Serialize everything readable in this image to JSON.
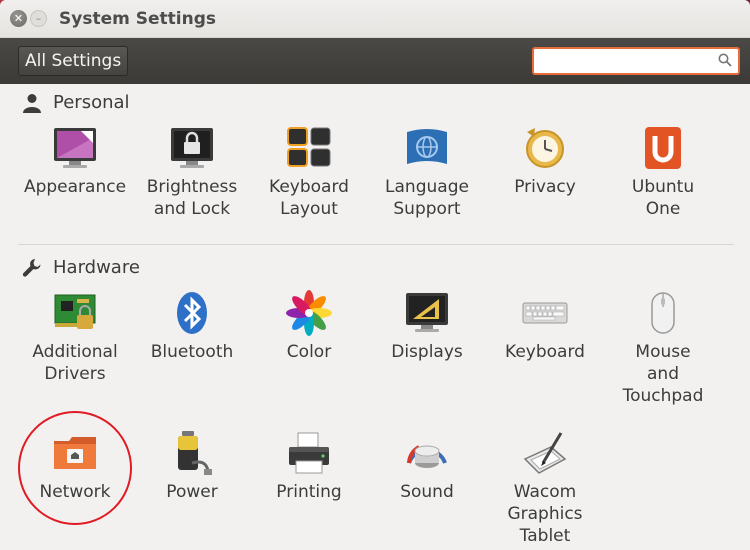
{
  "window": {
    "title": "System Settings"
  },
  "toolbar": {
    "all_settings_label": "All Settings",
    "search_value": ""
  },
  "sections": {
    "personal": {
      "title": "Personal"
    },
    "hardware": {
      "title": "Hardware"
    }
  },
  "personal_items": [
    {
      "label": "Appearance",
      "icon": "appearance-icon"
    },
    {
      "label": "Brightness\nand Lock",
      "icon": "brightness-lock-icon"
    },
    {
      "label": "Keyboard\nLayout",
      "icon": "keyboard-layout-icon"
    },
    {
      "label": "Language\nSupport",
      "icon": "language-support-icon"
    },
    {
      "label": "Privacy",
      "icon": "privacy-icon"
    },
    {
      "label": "Ubuntu\nOne",
      "icon": "ubuntu-one-icon"
    }
  ],
  "hardware_items": [
    {
      "label": "Additional\nDrivers",
      "icon": "additional-drivers-icon"
    },
    {
      "label": "Bluetooth",
      "icon": "bluetooth-icon"
    },
    {
      "label": "Color",
      "icon": "color-icon"
    },
    {
      "label": "Displays",
      "icon": "displays-icon"
    },
    {
      "label": "Keyboard",
      "icon": "keyboard-icon"
    },
    {
      "label": "Mouse\nand\nTouchpad",
      "icon": "mouse-icon"
    },
    {
      "label": "Network",
      "icon": "network-icon"
    },
    {
      "label": "Power",
      "icon": "power-icon"
    },
    {
      "label": "Printing",
      "icon": "printer-icon"
    },
    {
      "label": "Sound",
      "icon": "sound-icon"
    },
    {
      "label": "Wacom\nGraphics\nTablet",
      "icon": "wacom-tablet-icon"
    }
  ],
  "colors": {
    "accent": "#e86d3a",
    "highlight_circle": "#e01b24",
    "toolbar": "#403e3b"
  }
}
